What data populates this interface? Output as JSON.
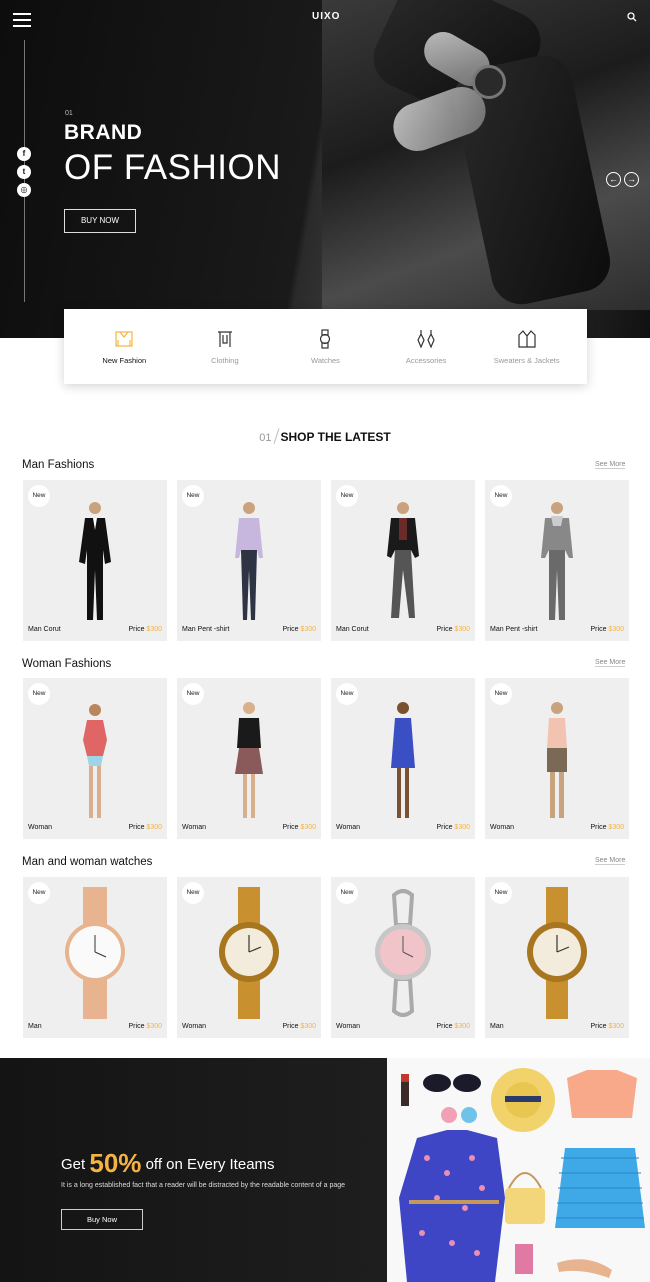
{
  "header": {
    "logo": "UIXO",
    "menu_icon": "hamburger-icon",
    "search_icon": "search-icon"
  },
  "hero": {
    "number": "01",
    "brand": "BRAND",
    "title": "OF FASHION",
    "button": "BUY NOW",
    "social": [
      "facebook-icon",
      "twitter-icon",
      "instagram-icon"
    ],
    "prev_arrow": "←",
    "next_arrow": "→"
  },
  "categories": [
    {
      "label": "New Fashion",
      "icon": "dress-icon",
      "active": true
    },
    {
      "label": "Clothing",
      "icon": "clothing-rack-icon",
      "active": false
    },
    {
      "label": "Watches",
      "icon": "watch-icon",
      "active": false
    },
    {
      "label": "Accessories",
      "icon": "earrings-icon",
      "active": false
    },
    {
      "label": "Sweaters & Jackets",
      "icon": "jacket-icon",
      "active": false
    }
  ],
  "shop": {
    "number": "01",
    "title": "SHOP THE LATEST",
    "see_more": "See More",
    "badge": "New",
    "price_label": "Price",
    "sections": [
      {
        "title": "Man Fashions",
        "items": [
          {
            "name": "Man Corut",
            "price": "$300"
          },
          {
            "name": "Man Pent -shirt",
            "price": "$300"
          },
          {
            "name": "Man Corut",
            "price": "$300"
          },
          {
            "name": "Man Pent -shirt",
            "price": "$300"
          }
        ]
      },
      {
        "title": "Woman Fashions",
        "items": [
          {
            "name": "Woman",
            "price": "$300"
          },
          {
            "name": "Woman",
            "price": "$300"
          },
          {
            "name": "Woman",
            "price": "$300"
          },
          {
            "name": "Woman",
            "price": "$300"
          }
        ]
      },
      {
        "title": "Man and woman watches",
        "items": [
          {
            "name": "Man",
            "price": "$300"
          },
          {
            "name": "Woman",
            "price": "$300"
          },
          {
            "name": "Woman",
            "price": "$300"
          },
          {
            "name": "Man",
            "price": "$300"
          }
        ]
      }
    ]
  },
  "promo": {
    "prefix": "Get",
    "percent": "50%",
    "suffix": "off on Every Iteams",
    "text": "It is a long established fact that a reader will be distracted by the readable content of a page",
    "button": "Buy Now"
  },
  "colors": {
    "accent": "#f5b342",
    "dark": "#141414",
    "card_bg": "#efefef"
  }
}
